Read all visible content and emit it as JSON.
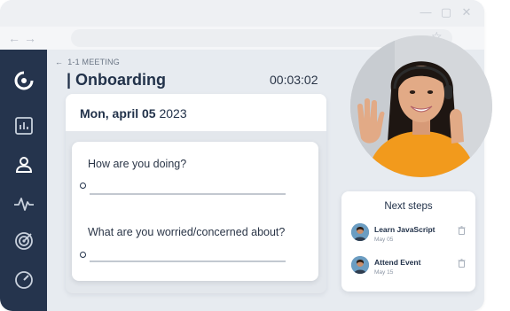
{
  "window": {
    "controls": [
      "—",
      "▢",
      "✕"
    ]
  },
  "browser": {
    "back": "←",
    "forward": "→",
    "star": "☆"
  },
  "sidebar": {
    "items": [
      {
        "name": "logo-icon"
      },
      {
        "name": "chart-icon"
      },
      {
        "name": "user-icon"
      },
      {
        "name": "activity-icon"
      },
      {
        "name": "target-icon"
      },
      {
        "name": "speedometer-icon"
      }
    ]
  },
  "header": {
    "back_arrow": "←",
    "breadcrumb": "1-1 MEETING",
    "title": "| Onboarding",
    "timer": "00:03:02"
  },
  "meeting": {
    "date_bold": "Mon, april 05",
    "date_year": "2023",
    "questions": [
      "How are you doing?",
      "What are you worried/concerned about?"
    ]
  },
  "next_steps": {
    "title": "Next steps",
    "items": [
      {
        "label": "Learn JavaScript",
        "date": "May 05"
      },
      {
        "label": "Attend Event",
        "date": "May 15"
      }
    ]
  },
  "colors": {
    "sidebar": "#25344d",
    "background": "#e7ebf0",
    "accent_orange": "#f29a1c"
  }
}
